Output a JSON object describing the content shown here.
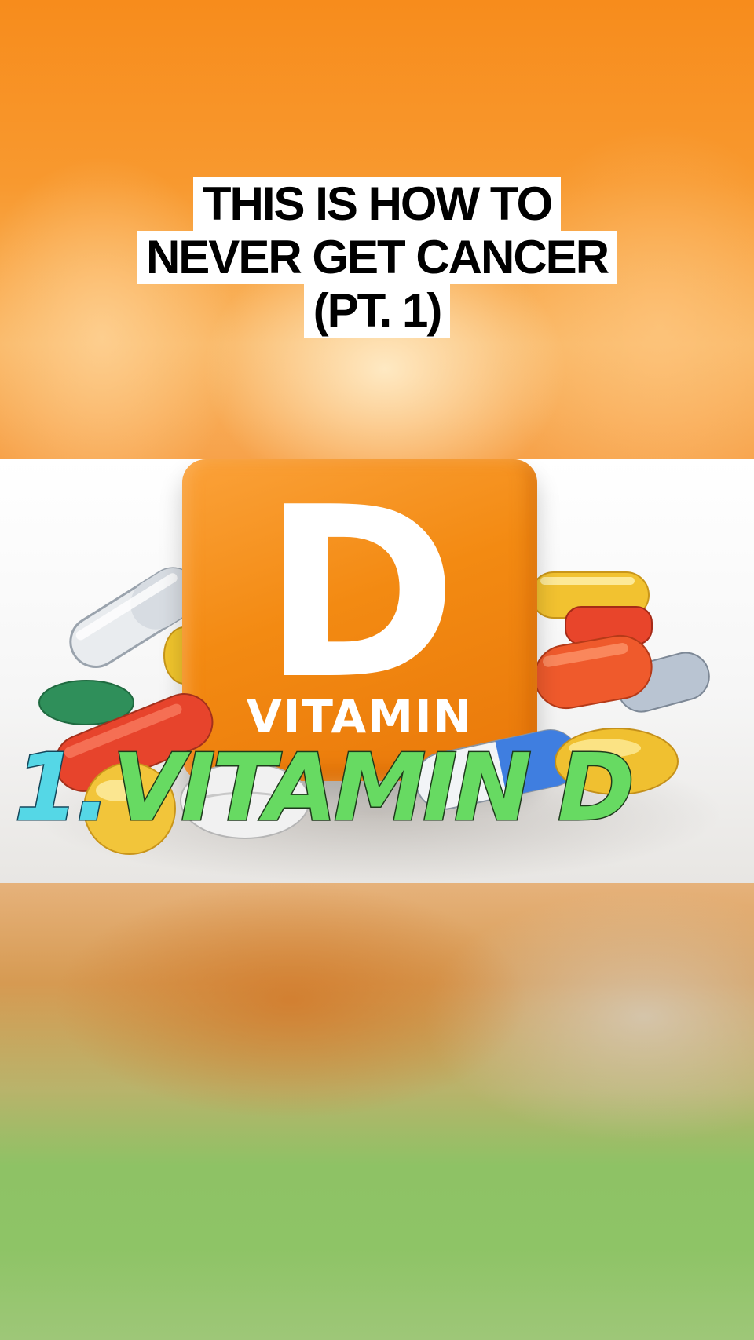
{
  "header": {
    "title_lines": [
      "THIS IS HOW TO",
      "NEVER GET CANCER",
      "(PT. 1)"
    ]
  },
  "image": {
    "cube_letter": "D",
    "cube_word": "VITAMIN"
  },
  "caption": {
    "number": "1.",
    "text": "VITAMIN D"
  },
  "colors": {
    "orange": "#f78c1c",
    "caption_number": "#55d7e6",
    "caption_text": "#67da62",
    "bottom_green": "#8ec466"
  }
}
